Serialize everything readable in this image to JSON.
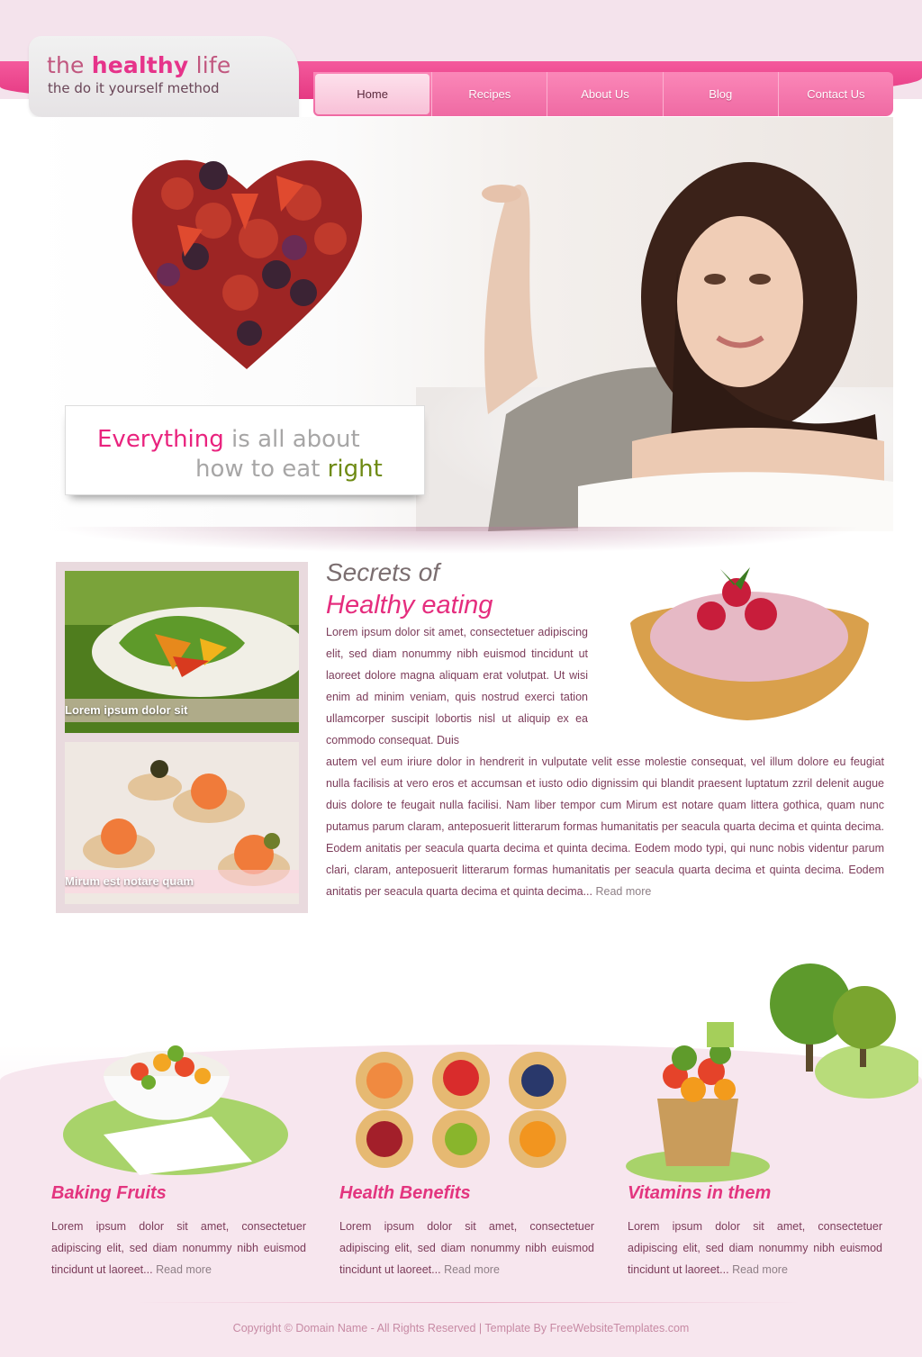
{
  "logo": {
    "title_part1": "the ",
    "title_part2": "healthy",
    "title_part3": " life",
    "subtitle": "the do it yourself method"
  },
  "nav": {
    "items": [
      {
        "label": "Home",
        "active": true
      },
      {
        "label": "Recipes",
        "active": false
      },
      {
        "label": "About Us",
        "active": false
      },
      {
        "label": "Blog",
        "active": false
      },
      {
        "label": "Contact Us",
        "active": false
      }
    ]
  },
  "hero": {
    "tagline_word1": "Everything",
    "tagline_rest1": " is all about",
    "tagline_word2": "how to eat ",
    "tagline_word3": "right"
  },
  "thumbs": [
    {
      "caption": "Lorem ipsum dolor sit"
    },
    {
      "caption": "Mirum est notare quam"
    }
  ],
  "article": {
    "title_line1": "Secrets of",
    "title_line2": "Healthy eating",
    "para_top": "Lorem ipsum dolor sit amet, consectetuer adipiscing elit, sed diam nonummy nibh euismod tincidunt ut laoreet dolore magna aliquam erat volutpat. Ut wisi enim ad minim veniam, quis nostrud exerci tation ullamcorper suscipit lobortis nisl ut aliquip ex ea commodo consequat. Duis",
    "para_bottom": "autem vel eum iriure dolor in hendrerit in vulputate velit esse molestie consequat, vel illum dolore eu feugiat nulla facilisis at vero eros et accumsan et iusto odio dignissim qui blandit praesent luptatum zzril delenit augue duis dolore te feugait nulla facilisi. Nam liber tempor cum Mirum est notare quam littera gothica, quam nunc putamus parum claram, anteposuerit litterarum formas humanitatis per seacula quarta decima et quinta decima. Eodem anitatis per seacula quarta decima et quinta decima. Eodem modo typi, qui nunc nobis videntur parum clari, claram, anteposuerit litterarum formas humanitatis per seacula quarta decima et quinta decima. Eodem anitatis per seacula quarta decima et quinta decima...",
    "read_more": "Read more"
  },
  "features": [
    {
      "title": "Baking Fruits",
      "text": "Lorem ipsum dolor sit amet, consectetuer adipiscing elit, sed diam nonummy nibh euismod tincidunt ut laoreet...",
      "read_more": "Read more"
    },
    {
      "title": "Health Benefits",
      "text": "Lorem ipsum dolor sit amet, consectetuer adipiscing elit, sed diam nonummy nibh euismod tincidunt ut laoreet...",
      "read_more": "Read more"
    },
    {
      "title": "Vitamins in them",
      "text": "Lorem ipsum dolor sit amet, consectetuer adipiscing elit, sed diam nonummy nibh euismod tincidunt ut laoreet...",
      "read_more": "Read more"
    }
  ],
  "footer": {
    "text": "Copyright © Domain Name - All Rights Reserved | Template By FreeWebsiteTemplates.com"
  },
  "colors": {
    "accent_pink": "#e3357f",
    "nav_pink": "#f47aaf",
    "body_text": "#7c3c5a",
    "background": "#f4e3ec"
  }
}
